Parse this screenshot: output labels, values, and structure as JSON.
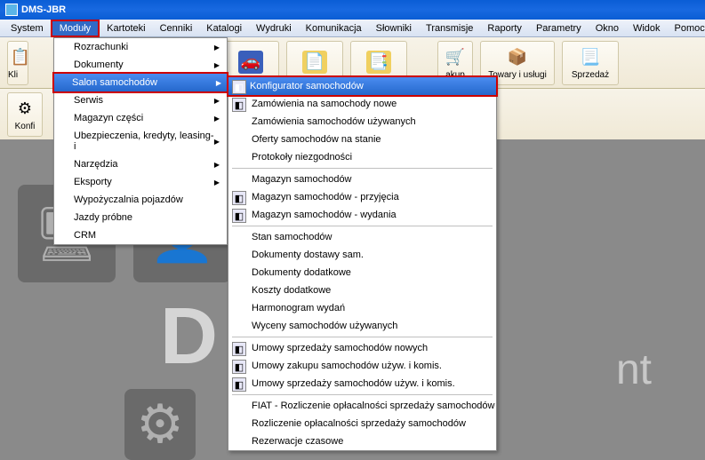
{
  "window": {
    "title": "DMS-JBR"
  },
  "menubar": {
    "items": [
      "System",
      "Moduły",
      "Kartoteki",
      "Cenniki",
      "Katalogi",
      "Wydruki",
      "Komunikacja",
      "Słowniki",
      "Transmisje",
      "Raporty",
      "Parametry",
      "Okno",
      "Widok",
      "Pomoc"
    ],
    "active_index": 1
  },
  "toolbar": {
    "items": [
      {
        "label": "Kli",
        "partial": true
      },
      {
        "label": "",
        "hidden": true
      },
      {
        "label": "",
        "hidden": true
      },
      {
        "label": "",
        "hidden": true
      },
      {
        "label": "",
        "hidden": true
      },
      {
        "label": "akup",
        "partial": true
      },
      {
        "label": "Towary i usługi"
      },
      {
        "label": "Sprzedaż"
      }
    ]
  },
  "toolbar2": {
    "items": [
      {
        "label": "Konfi",
        "partial": true
      }
    ]
  },
  "dropdown_modules": {
    "items": [
      {
        "label": "Rozrachunki",
        "has_submenu": true
      },
      {
        "label": "Dokumenty",
        "has_submenu": true
      },
      {
        "label": "Salon samochodów",
        "has_submenu": true,
        "highlighted": true
      },
      {
        "label": "Serwis",
        "has_submenu": true
      },
      {
        "label": "Magazyn części",
        "has_submenu": true
      },
      {
        "label": "Ubezpieczenia, kredyty, leasing-i",
        "has_submenu": true
      },
      {
        "label": "Narzędzia",
        "has_submenu": true
      },
      {
        "label": "Eksporty",
        "has_submenu": true
      },
      {
        "label": "Wypożyczalnia pojazdów"
      },
      {
        "label": "Jazdy próbne"
      },
      {
        "label": "CRM"
      }
    ]
  },
  "dropdown_salon": {
    "groups": [
      [
        {
          "label": "Konfigurator samochodów",
          "icon": true,
          "highlighted": true
        },
        {
          "label": "Zamówienia na samochody nowe",
          "icon": true
        },
        {
          "label": "Zamówienia samochodów używanych"
        },
        {
          "label": "Oferty samochodów na stanie"
        },
        {
          "label": "Protokoły niezgodności"
        }
      ],
      [
        {
          "label": "Magazyn samochodów"
        },
        {
          "label": "Magazyn samochodów - przyjęcia",
          "icon": true
        },
        {
          "label": "Magazyn samochodów - wydania",
          "icon": true
        }
      ],
      [
        {
          "label": "Stan samochodów"
        },
        {
          "label": "Dokumenty dostawy sam."
        },
        {
          "label": "Dokumenty dodatkowe"
        },
        {
          "label": "Koszty dodatkowe"
        },
        {
          "label": "Harmonogram wydań"
        },
        {
          "label": "Wyceny samochodów używanych"
        }
      ],
      [
        {
          "label": "Umowy sprzedaży samochodów nowych",
          "icon": true
        },
        {
          "label": "Umowy zakupu samochodów używ. i komis.",
          "icon": true
        },
        {
          "label": "Umowy sprzedaży samochodów używ. i komis.",
          "icon": true
        }
      ],
      [
        {
          "label": "FIAT - Rozliczenie opłacalności sprzedaży samochodów"
        },
        {
          "label": "Rozliczenie opłacalności sprzedaży samochodów"
        },
        {
          "label": "Rezerwacje czasowe"
        }
      ]
    ]
  }
}
